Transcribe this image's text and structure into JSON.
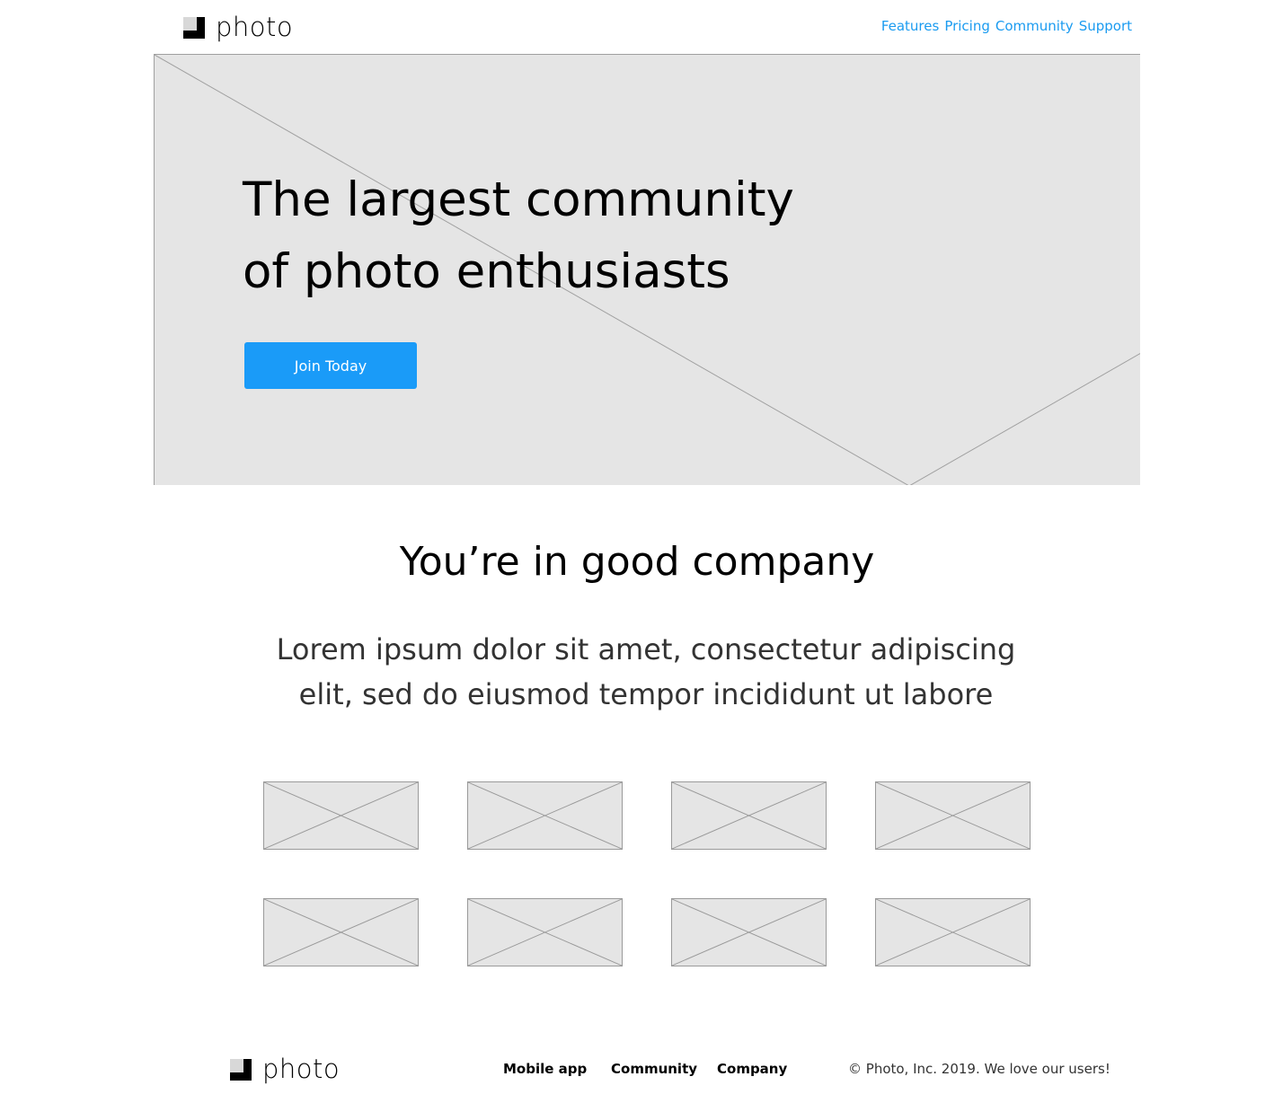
{
  "header": {
    "logo_text": "photo",
    "nav": [
      "Features",
      "Pricing",
      "Community",
      "Support"
    ]
  },
  "hero": {
    "title_line1": "The largest community",
    "title_line2": "of photo enthusiasts",
    "cta_label": "Join Today"
  },
  "company": {
    "title": "You’re in good company",
    "subtitle_line1": "Lorem ipsum dolor sit amet, consectetur adipiscing",
    "subtitle_line2": "elit, sed do eiusmod tempor incididunt ut labore"
  },
  "footer": {
    "logo_text": "photo",
    "links": [
      "Mobile app",
      "Community",
      "Company"
    ],
    "copyright": "© Photo, Inc. 2019. We love our users!"
  },
  "colors": {
    "accent": "#1a9bf0",
    "button": "#1a9bf8",
    "placeholder_fill": "#e5e5e5",
    "placeholder_line": "#9a9a9a"
  },
  "icons": {
    "logo": "photo-logo-icon",
    "placeholder": "image-placeholder-icon"
  }
}
